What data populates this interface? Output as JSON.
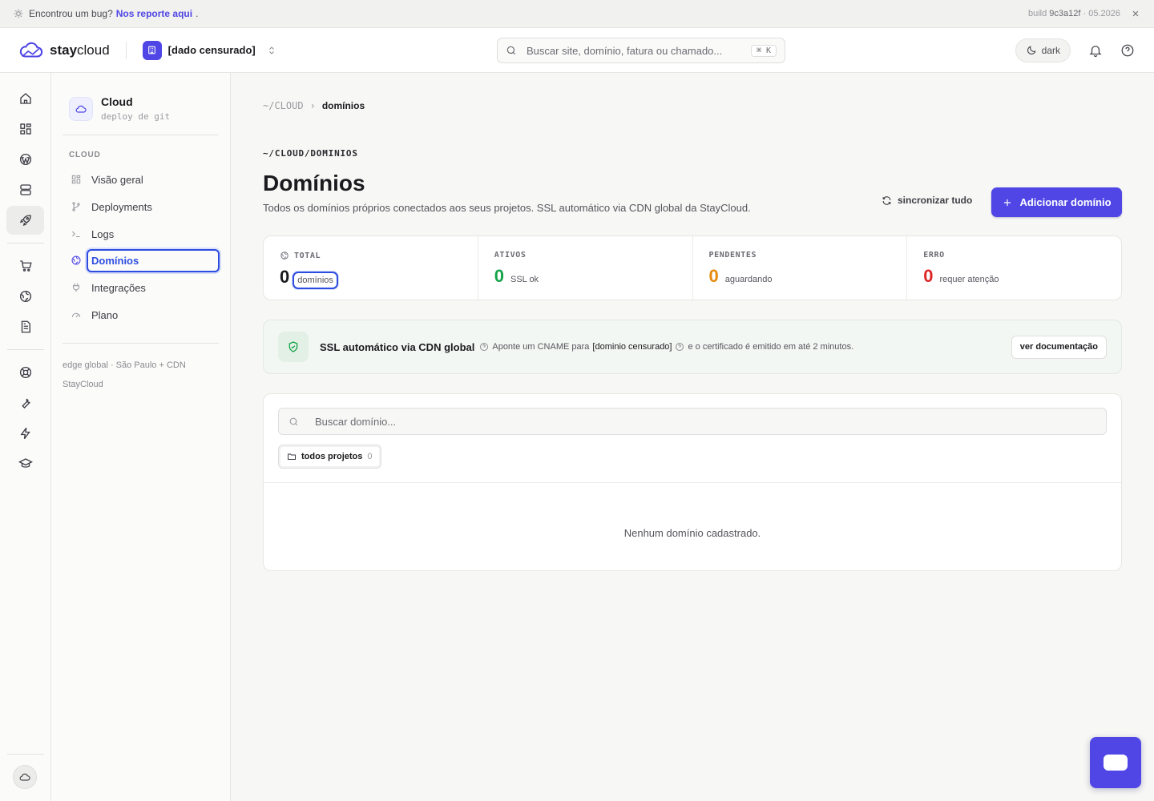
{
  "banner": {
    "message": "Encontrou um bug?",
    "link": "Nos reporte aqui",
    "period": ".",
    "build_label": "build",
    "build_hash": "9c3a12f",
    "build_date": "· 05.2026"
  },
  "header": {
    "brand_bold": "stay",
    "brand_rest": "cloud",
    "org_name": "[dado censurado]",
    "search_placeholder": "Buscar site, domínio, fatura ou chamado...",
    "search_shortcut": "⌘ K",
    "theme_label": "dark"
  },
  "sidebar": {
    "title": "Cloud",
    "subtitle": "deploy de git",
    "section": "CLOUD",
    "items": [
      {
        "label": "Visão geral"
      },
      {
        "label": "Deployments"
      },
      {
        "label": "Logs"
      },
      {
        "label": "Domínios"
      },
      {
        "label": "Integrações"
      },
      {
        "label": "Plano"
      }
    ],
    "footer_line1": "edge global · São Paulo + CDN",
    "footer_line2": "StayCloud"
  },
  "main": {
    "breadcrumb_root": "~/CLOUD",
    "breadcrumb_sep": "›",
    "breadcrumb_current": "domínios",
    "eyebrow": "~/CLOUD/DOMINIOS",
    "title": "Domínios",
    "description": "Todos os domínios próprios conectados aos seus projetos. SSL automático via CDN global da StayCloud.",
    "sync_label": "sincronizar tudo",
    "add_label": "Adicionar domínio",
    "stats": [
      {
        "label": "TOTAL",
        "value": "0",
        "sub": "domínios"
      },
      {
        "label": "ATIVOS",
        "value": "0",
        "sub": "SSL ok"
      },
      {
        "label": "PENDENTES",
        "value": "0",
        "sub": "aguardando"
      },
      {
        "label": "ERRO",
        "value": "0",
        "sub": "requer atenção"
      }
    ],
    "ssl": {
      "title": "SSL automático via CDN global",
      "text_a": "Aponte um CNAME para",
      "text_domain": "[dominio censurado]",
      "text_b": "e o certificado é emitido em até 2 minutos.",
      "doc_label": "ver documentação"
    },
    "domain_search_placeholder": "Buscar domínio...",
    "filter_chip": {
      "label": "todos projetos",
      "count": "0"
    },
    "empty_state": "Nenhum domínio cadastrado."
  },
  "colors": {
    "accent": "#4f46e5",
    "success": "#16a34a",
    "warning": "#e58a0c",
    "danger": "#dc2626"
  }
}
